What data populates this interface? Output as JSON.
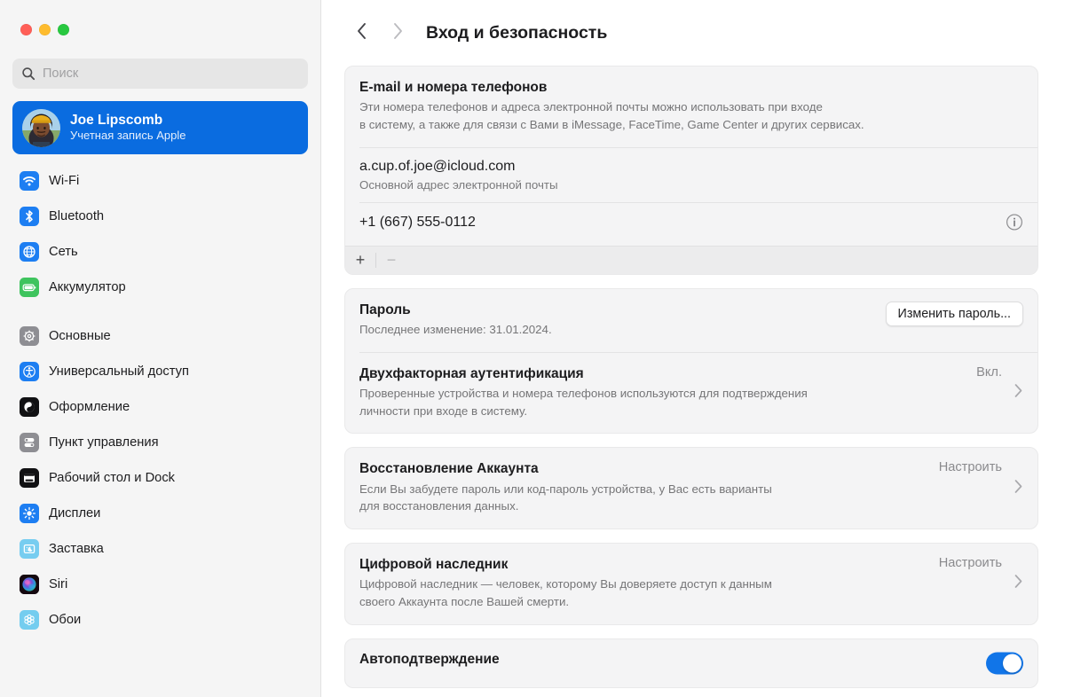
{
  "window": {
    "controls": [
      "close",
      "minimize",
      "zoom"
    ]
  },
  "search": {
    "placeholder": "Поиск",
    "value": ""
  },
  "account": {
    "name": "Joe Lipscomb",
    "subtitle": "Учетная запись Apple"
  },
  "sidebar": {
    "groups": [
      {
        "items": [
          {
            "label": "Wi-Fi",
            "icon": "wifi-icon"
          },
          {
            "label": "Bluetooth",
            "icon": "bluetooth-icon"
          },
          {
            "label": "Сеть",
            "icon": "network-icon"
          },
          {
            "label": "Аккумулятор",
            "icon": "battery-icon"
          }
        ]
      },
      {
        "items": [
          {
            "label": "Основные",
            "icon": "gear-icon"
          },
          {
            "label": "Универсальный доступ",
            "icon": "accessibility-icon"
          },
          {
            "label": "Оформление",
            "icon": "appearance-icon"
          },
          {
            "label": "Пункт управления",
            "icon": "control-center-icon"
          },
          {
            "label": "Рабочий стол и Dock",
            "icon": "desktop-dock-icon"
          },
          {
            "label": "Дисплеи",
            "icon": "displays-icon"
          },
          {
            "label": "Заставка",
            "icon": "screensaver-icon"
          },
          {
            "label": "Siri",
            "icon": "siri-icon"
          },
          {
            "label": "Обои",
            "icon": "wallpaper-icon"
          }
        ]
      }
    ]
  },
  "header": {
    "back_icon": "chevron-left-icon",
    "forward_icon": "chevron-right-icon",
    "title": "Вход и безопасность"
  },
  "cards": {
    "contact": {
      "title": "E-mail и номера телефонов",
      "desc_line1": "Эти номера телефонов и адреса электронной почты можно использовать при входе",
      "desc_line2": "в систему, а также для связи с Вами в iMessage, FaceTime, Game Center и других сервисах.",
      "email": "a.cup.of.joe@icloud.com",
      "email_sub": "Основной адрес электронной почты",
      "phone": "+1 (667) 555-0112",
      "info_icon": "info-circle-icon",
      "add_label": "+",
      "remove_label": "−"
    },
    "password": {
      "title": "Пароль",
      "desc": "Последнее изменение: 31.01.2024.",
      "button": "Изменить пароль...",
      "twofa_title": "Двухфакторная аутентификация",
      "twofa_value": "Вкл.",
      "twofa_desc_line1": "Проверенные устройства и номера телефонов используются для подтверждения",
      "twofa_desc_line2": "личности при входе в систему."
    },
    "recovery": {
      "title": "Восстановление Аккаунта",
      "value": "Настроить",
      "desc_line1": "Если Вы забудете пароль или код-пароль устройства, у Вас есть варианты",
      "desc_line2": "для восстановления данных."
    },
    "legacy": {
      "title": "Цифровой наследник",
      "value": "Настроить",
      "desc_line1": "Цифровой наследник — человек, которому Вы доверяете доступ к данным",
      "desc_line2": "своего Аккаунта после Вашей смерти."
    },
    "autoverify": {
      "title": "Автоподтверждение",
      "toggle_state": "on"
    }
  },
  "colors": {
    "accent": "#0a6ce0",
    "toggle_on": "#1175e8",
    "sidebar_bg": "#f5f5f5",
    "card_bg": "#f4f4f5"
  }
}
